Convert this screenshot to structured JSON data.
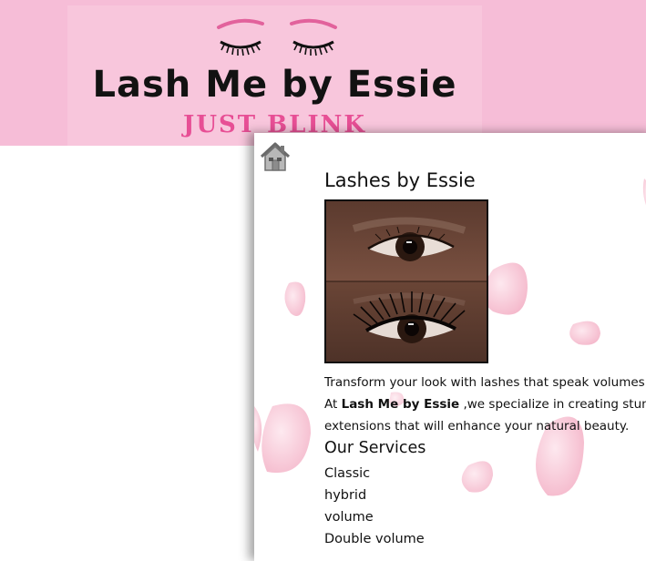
{
  "banner": {
    "title": "Lash Me by Essie",
    "tagline": "JUST BLINK"
  },
  "nav": {
    "home_icon": "home-icon"
  },
  "main": {
    "heading": "Lashes by Essie",
    "image_icon": "eyelash-before-after-photo",
    "intro_line1": "Transform your look with lashes that speak volumes!",
    "intro_prefix": "At ",
    "intro_brand": "Lash Me by Essie",
    "intro_line2_rest": " ,we specialize in creating stunnin",
    "intro_line3": "extensions that will enhance your natural beauty.",
    "services_heading": "Our Services",
    "services": [
      "Classic",
      "hybrid",
      "volume",
      "Double volume"
    ]
  },
  "colors": {
    "top_band": "#f6bdd7",
    "banner_bg": "#f8c6dc",
    "tagline": "#e74f95",
    "petal": "#f4b6c8"
  }
}
